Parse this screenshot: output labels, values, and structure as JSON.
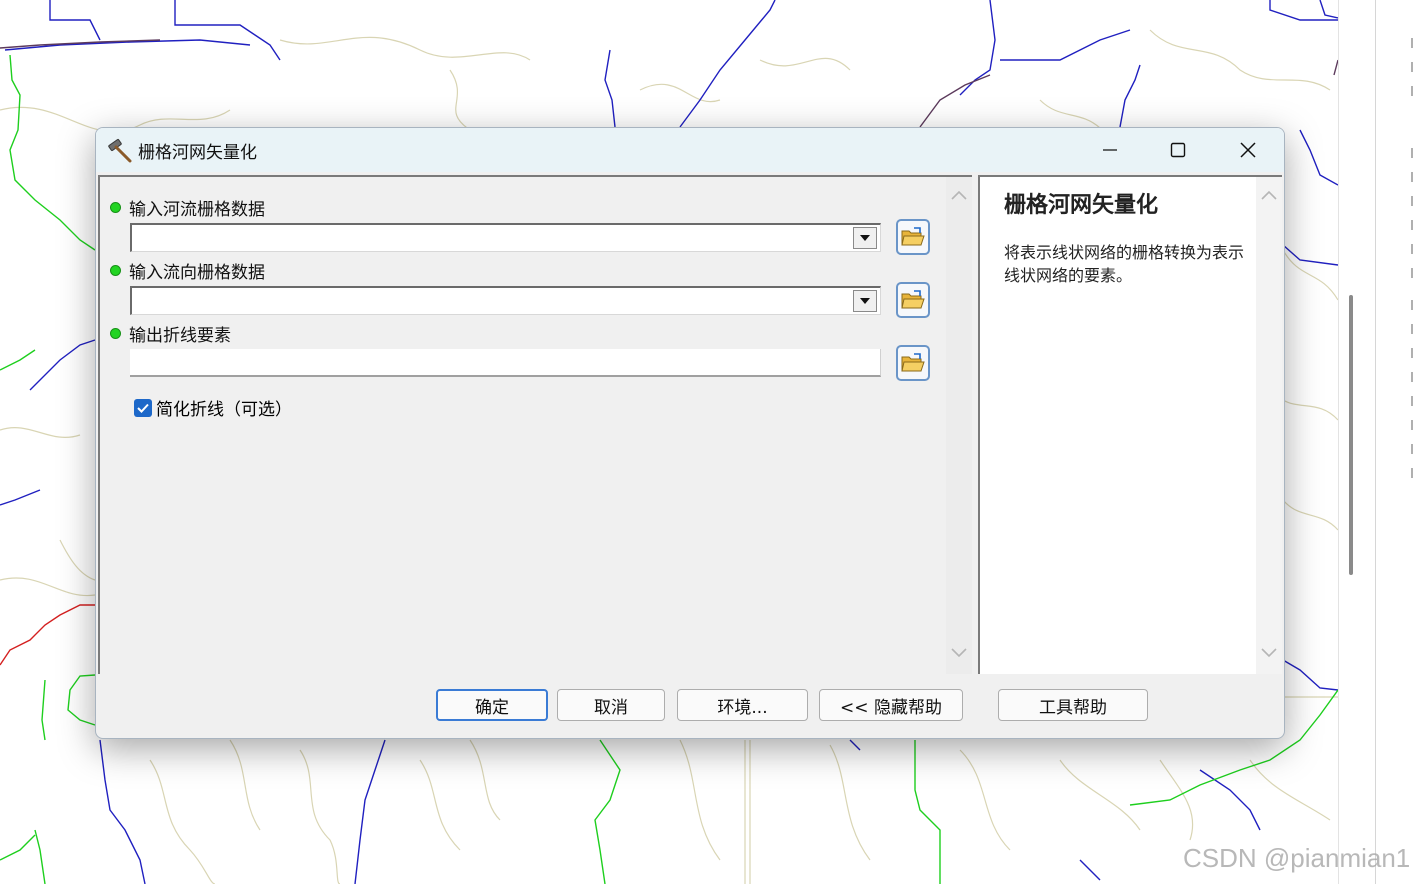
{
  "dialog": {
    "title": "栅格河网矢量化",
    "window_buttons": {
      "minimize": "minimize-icon",
      "maximize": "maximize-icon",
      "close": "close-icon"
    }
  },
  "params": [
    {
      "label": "输入河流栅格数据",
      "required": true,
      "control": "combo",
      "value": ""
    },
    {
      "label": "输入流向栅格数据",
      "required": true,
      "control": "combo",
      "value": ""
    },
    {
      "label": "输出折线要素",
      "required": true,
      "control": "text",
      "value": ""
    }
  ],
  "option": {
    "label": "简化折线（可选）",
    "checked": true
  },
  "help": {
    "title": "栅格河网矢量化",
    "description": "将表示线状网络的栅格转换为表示线状网络的要素。"
  },
  "buttons": {
    "ok": "确定",
    "cancel": "取消",
    "environments": "环境...",
    "hide_help": "<< 隐藏帮助",
    "tool_help": "工具帮助"
  },
  "watermark": "CSDN @pianmian1",
  "colors": {
    "required_dot": "#22d422",
    "checkbox": "#1d68c9",
    "ok_border": "#3a7bd5",
    "titlebar": "#e9f3f7"
  }
}
